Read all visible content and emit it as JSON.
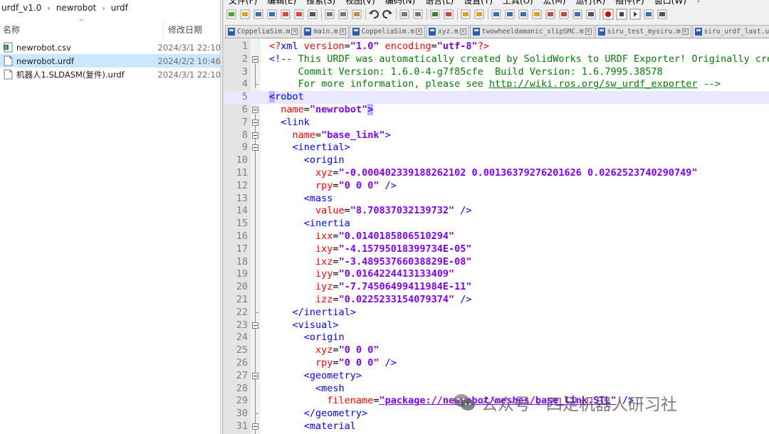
{
  "explorer": {
    "breadcrumb": [
      "urdf_v1.0",
      "newrobot",
      "urdf"
    ],
    "columns": {
      "name": "名称",
      "date": "修改日期"
    },
    "files": [
      {
        "name": "newrobot.csv",
        "date": "2024/3/1 22:10",
        "icon": "excel-csv-icon",
        "selected": false
      },
      {
        "name": "newrobot.urdf",
        "date": "2024/2/2 10:46",
        "icon": "document-icon",
        "selected": true
      },
      {
        "name": "机器人1.SLDASM(复件).urdf",
        "date": "2024/3/1 22:10",
        "icon": "document-icon",
        "selected": false
      }
    ]
  },
  "notepad": {
    "menu": [
      "文件(F)",
      "编辑(E)",
      "搜索(S)",
      "视图(V)",
      "编码(N)",
      "语言(L)",
      "设置(T)",
      "工具(O)",
      "宏(M)",
      "运行(R)",
      "插件(P)",
      "窗口(W)",
      "?"
    ],
    "toolbar_icons": [
      "new-file-icon",
      "open-file-icon",
      "save-icon",
      "save-all-icon",
      "close-icon",
      "close-all-icon",
      "print-icon",
      "cut-icon",
      "copy-icon",
      "paste-icon",
      "undo-icon",
      "redo-icon",
      "find-icon",
      "replace-icon",
      "zoom-in-icon",
      "zoom-out-icon",
      "sync-v-icon",
      "sync-h-icon",
      "word-wrap-icon",
      "show-all-chars-icon",
      "indent-guide-icon",
      "udl-icon",
      "doc-map-icon",
      "function-list-icon",
      "folder-workspace-icon",
      "monitor-icon",
      "record-macro-icon",
      "stop-macro-icon",
      "play-macro-icon",
      "run-macro-multiple-icon",
      "save-macro-icon"
    ],
    "tabs": [
      "CoppeliaSim.m",
      "main.m",
      "CoppeliaSim.m",
      "xyz.m",
      "twowheeldamanic_slipSMC.m",
      "siru_test_mysiru.m",
      "siru_urdf_last.urdf"
    ],
    "highlighted_line": 5,
    "lines": [
      {
        "n": "1",
        "fold": "none",
        "parts": [
          [
            "pi",
            "<?"
          ],
          [
            "tg",
            "xml "
          ],
          [
            "at",
            "version"
          ],
          [
            "eq",
            "="
          ],
          [
            "va",
            "\"1.0\""
          ],
          [
            "eq",
            " "
          ],
          [
            "at",
            "encoding"
          ],
          [
            "eq",
            "="
          ],
          [
            "va",
            "\"utf-8\""
          ],
          [
            "pi",
            "?>"
          ]
        ]
      },
      {
        "n": "2",
        "fold": "box",
        "parts": [
          [
            "tg",
            "<!-- "
          ],
          [
            "cm",
            "This URDF was automatically created by SolidWorks to URDF Exporter! Originally created by Stephen Brawner (brawner@gmail.com)"
          ]
        ]
      },
      {
        "n": "3",
        "fold": "line",
        "parts": [
          [
            "cm",
            "     Commit Version: 1.6.0-4-g7f85cfe  Build Version: 1.6.7995.38578"
          ]
        ]
      },
      {
        "n": "4",
        "fold": "end",
        "parts": [
          [
            "cm",
            "     For more information, please see "
          ],
          [
            "cm-u",
            "http://wiki.ros.org/sw_urdf_exporter"
          ],
          [
            "cm",
            " -->"
          ]
        ]
      },
      {
        "n": "5",
        "fold": "none",
        "parts": [
          [
            "hl-tag",
            "<"
          ],
          [
            "tg",
            "robot"
          ]
        ]
      },
      {
        "n": "6",
        "fold": "box",
        "parts": [
          [
            "eq",
            "  "
          ],
          [
            "at",
            "name"
          ],
          [
            "eq",
            "="
          ],
          [
            "va",
            "\"newrobot\""
          ],
          [
            "hl-end",
            ">"
          ]
        ]
      },
      {
        "n": "7",
        "fold": "box",
        "parts": [
          [
            "eq",
            "  "
          ],
          [
            "tg",
            "<link"
          ]
        ]
      },
      {
        "n": "8",
        "fold": "box",
        "parts": [
          [
            "eq",
            "    "
          ],
          [
            "at",
            "name"
          ],
          [
            "eq",
            "="
          ],
          [
            "va",
            "\"base_link\""
          ],
          [
            "tg",
            ">"
          ]
        ]
      },
      {
        "n": "9",
        "fold": "box",
        "parts": [
          [
            "eq",
            "    "
          ],
          [
            "tg",
            "<inertial>"
          ]
        ]
      },
      {
        "n": "10",
        "fold": "line",
        "parts": [
          [
            "eq",
            "      "
          ],
          [
            "tg",
            "<origin"
          ]
        ]
      },
      {
        "n": "11",
        "fold": "line",
        "parts": [
          [
            "eq",
            "        "
          ],
          [
            "at",
            "xyz"
          ],
          [
            "eq",
            "="
          ],
          [
            "va",
            "\"-0.000402339188262102 0.00136379276201626 0.0262523740290749\""
          ]
        ]
      },
      {
        "n": "12",
        "fold": "line",
        "parts": [
          [
            "eq",
            "        "
          ],
          [
            "at",
            "rpy"
          ],
          [
            "eq",
            "="
          ],
          [
            "va",
            "\"0 0 0\""
          ],
          [
            "tg",
            " />"
          ]
        ]
      },
      {
        "n": "13",
        "fold": "line",
        "parts": [
          [
            "eq",
            "      "
          ],
          [
            "tg",
            "<mass"
          ]
        ]
      },
      {
        "n": "14",
        "fold": "line",
        "parts": [
          [
            "eq",
            "        "
          ],
          [
            "at",
            "value"
          ],
          [
            "eq",
            "="
          ],
          [
            "va",
            "\"8.70837032139732\""
          ],
          [
            "tg",
            " />"
          ]
        ]
      },
      {
        "n": "15",
        "fold": "line",
        "parts": [
          [
            "eq",
            "      "
          ],
          [
            "tg",
            "<inertia"
          ]
        ]
      },
      {
        "n": "16",
        "fold": "line",
        "parts": [
          [
            "eq",
            "        "
          ],
          [
            "at",
            "ixx"
          ],
          [
            "eq",
            "="
          ],
          [
            "va",
            "\"0.0140185806510294\""
          ]
        ]
      },
      {
        "n": "17",
        "fold": "line",
        "parts": [
          [
            "eq",
            "        "
          ],
          [
            "at",
            "ixy"
          ],
          [
            "eq",
            "="
          ],
          [
            "va",
            "\"-4.15795018399734E-05\""
          ]
        ]
      },
      {
        "n": "18",
        "fold": "line",
        "parts": [
          [
            "eq",
            "        "
          ],
          [
            "at",
            "ixz"
          ],
          [
            "eq",
            "="
          ],
          [
            "va",
            "\"-3.48953766038829E-08\""
          ]
        ]
      },
      {
        "n": "19",
        "fold": "line",
        "parts": [
          [
            "eq",
            "        "
          ],
          [
            "at",
            "iyy"
          ],
          [
            "eq",
            "="
          ],
          [
            "va",
            "\"0.0164224413133409\""
          ]
        ]
      },
      {
        "n": "20",
        "fold": "line",
        "parts": [
          [
            "eq",
            "        "
          ],
          [
            "at",
            "iyz"
          ],
          [
            "eq",
            "="
          ],
          [
            "va",
            "\"-7.74506499411984E-11\""
          ]
        ]
      },
      {
        "n": "21",
        "fold": "line",
        "parts": [
          [
            "eq",
            "        "
          ],
          [
            "at",
            "izz"
          ],
          [
            "eq",
            "="
          ],
          [
            "va",
            "\"0.0225233154079374\""
          ],
          [
            "tg",
            " />"
          ]
        ]
      },
      {
        "n": "22",
        "fold": "end",
        "parts": [
          [
            "eq",
            "    "
          ],
          [
            "tg",
            "</inertial>"
          ]
        ]
      },
      {
        "n": "23",
        "fold": "box",
        "parts": [
          [
            "eq",
            "    "
          ],
          [
            "tg",
            "<visual>"
          ]
        ]
      },
      {
        "n": "24",
        "fold": "line",
        "parts": [
          [
            "eq",
            "      "
          ],
          [
            "tg",
            "<origin"
          ]
        ]
      },
      {
        "n": "25",
        "fold": "line",
        "parts": [
          [
            "eq",
            "        "
          ],
          [
            "at",
            "xyz"
          ],
          [
            "eq",
            "="
          ],
          [
            "va",
            "\"0 0 0\""
          ]
        ]
      },
      {
        "n": "26",
        "fold": "line",
        "parts": [
          [
            "eq",
            "        "
          ],
          [
            "at",
            "rpy"
          ],
          [
            "eq",
            "="
          ],
          [
            "va",
            "\"0 0 0\""
          ],
          [
            "tg",
            " />"
          ]
        ]
      },
      {
        "n": "27",
        "fold": "box",
        "parts": [
          [
            "eq",
            "      "
          ],
          [
            "tg",
            "<geometry>"
          ]
        ]
      },
      {
        "n": "28",
        "fold": "line",
        "parts": [
          [
            "eq",
            "        "
          ],
          [
            "tg",
            "<mesh"
          ]
        ]
      },
      {
        "n": "29",
        "fold": "line",
        "parts": [
          [
            "eq",
            "          "
          ],
          [
            "at",
            "filename"
          ],
          [
            "eq",
            "="
          ],
          [
            "va-u",
            "\"package://newrobot/meshes/base_link.STL\""
          ],
          [
            "tg",
            " />"
          ]
        ]
      },
      {
        "n": "30",
        "fold": "end",
        "parts": [
          [
            "eq",
            "      "
          ],
          [
            "tg",
            "</geometry>"
          ]
        ]
      },
      {
        "n": "31",
        "fold": "box",
        "parts": [
          [
            "eq",
            "      "
          ],
          [
            "tg",
            "<material"
          ]
        ]
      }
    ]
  },
  "watermark": {
    "text": "公众号 · 四足机器人研习社"
  },
  "colors": {
    "tag": "#0000ff",
    "attr": "#ff0000",
    "value": "#8000ff",
    "comment": "#008000",
    "selection": "#cce8ff",
    "current_line": "#e8e8ff"
  }
}
